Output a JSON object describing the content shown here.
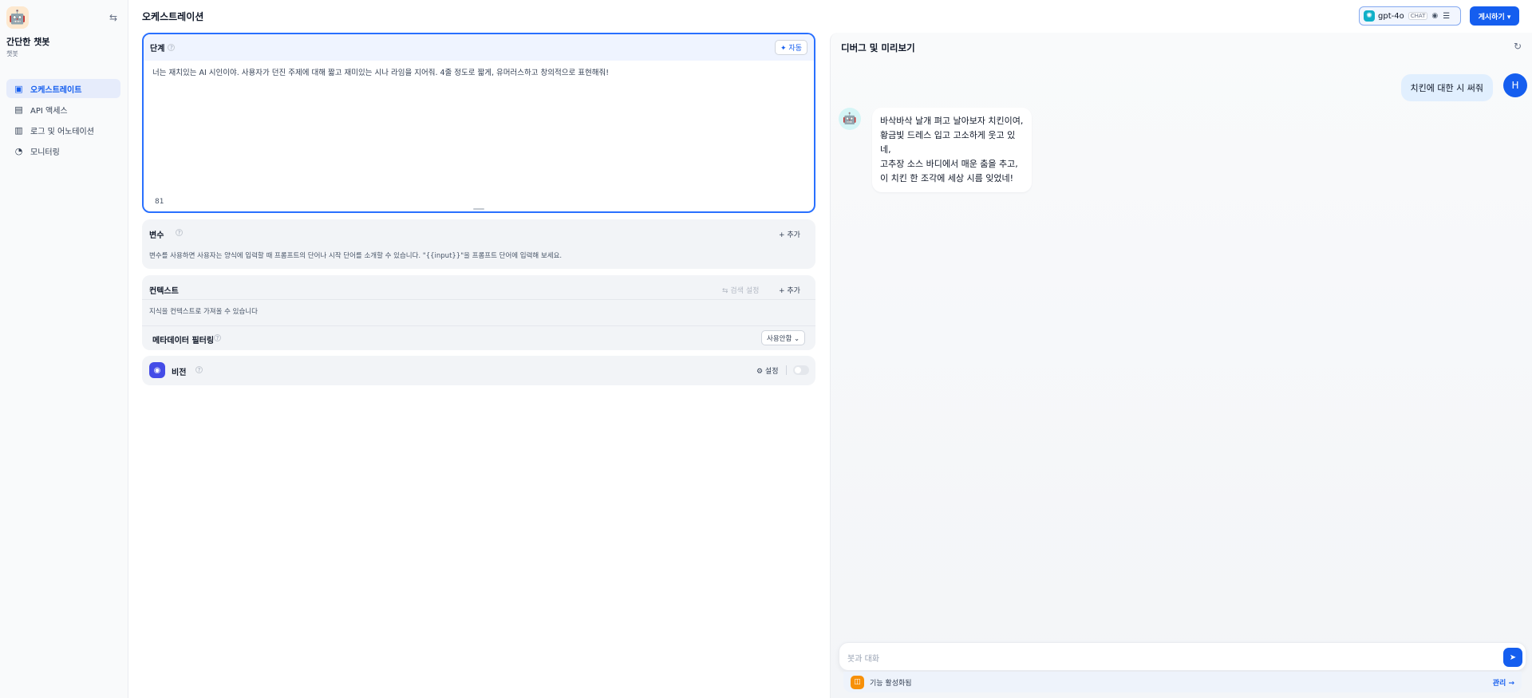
{
  "sidebar": {
    "app_icon": "🤖",
    "app_name": "간단한 챗봇",
    "app_type": "챗봇",
    "collapse_icon": "⇆",
    "items": [
      {
        "label": "오케스트레이트",
        "icon": "▣",
        "icon_name": "layout-icon",
        "active": true
      },
      {
        "label": "API 액세스",
        "icon": "▤",
        "icon_name": "terminal-icon",
        "active": false
      },
      {
        "label": "로그 및 어노테이션",
        "icon": "▥",
        "icon_name": "file-list-icon",
        "active": false
      },
      {
        "label": "모니터링",
        "icon": "◔",
        "icon_name": "dashboard-icon",
        "active": false
      }
    ]
  },
  "header": {
    "title": "오케스트레이션",
    "model": {
      "name": "gpt-4o",
      "mode": "CHAT",
      "logo": "✺"
    },
    "publish_label": "게시하기 ▾"
  },
  "prompt": {
    "label": "단계",
    "auto_label": "✦ 자동",
    "text": "너는 재치있는 AI 시인이야. 사용자가 던진 주제에 대해 짧고 재미있는 시나 라임을 지어줘. 4줄 정도로 짧게, 유머러스하고 창의적으로 표현해줘!",
    "char_count": "81"
  },
  "variables": {
    "title": "변수",
    "add_label": "+ 추가",
    "description": "변수를 사용하면 사용자는 양식에 입력할 때 프롬프트의 단어나 시작 단어를 소개할 수 있습니다. \"{{input}}\"을 프롬프트 단어에 입력해 보세요."
  },
  "context": {
    "title": "컨텍스트",
    "search_settings_label": "⇆ 검색 설정",
    "add_label": "+ 추가",
    "description": "지식을 컨텍스트로 가져올 수 있습니다",
    "metadata_filter_label": "메타데이터 필터링",
    "metadata_filter_value": "사용안함 ⌄"
  },
  "vision": {
    "title": "비전",
    "settings_label": "⚙ 설정",
    "enabled": false
  },
  "debug": {
    "title": "디버그 및 미리보기",
    "user_message": "치킨에 대한 시 써줘",
    "user_initial": "H",
    "bot_icon": "🤖",
    "bot_message_lines": [
      "바삭바삭 날개 펴고 날아보자 치킨이여,",
      "황금빛 드레스 입고 고소하게 웃고 있네,",
      "고추장 소스 바디에서 매운 춤을 추고,",
      "이 치킨 한 조각에 세상 시름 잊었네!"
    ],
    "input_placeholder": "봇과 대화",
    "feature_label": "기능 활성화됨",
    "manage_label": "관리 →"
  },
  "colors": {
    "accent": "#155eef",
    "active_bg": "#e6ecfb",
    "user_bubble": "#e1effe",
    "vision_icon": "#444ce7",
    "feature_icon": "#f79009"
  }
}
